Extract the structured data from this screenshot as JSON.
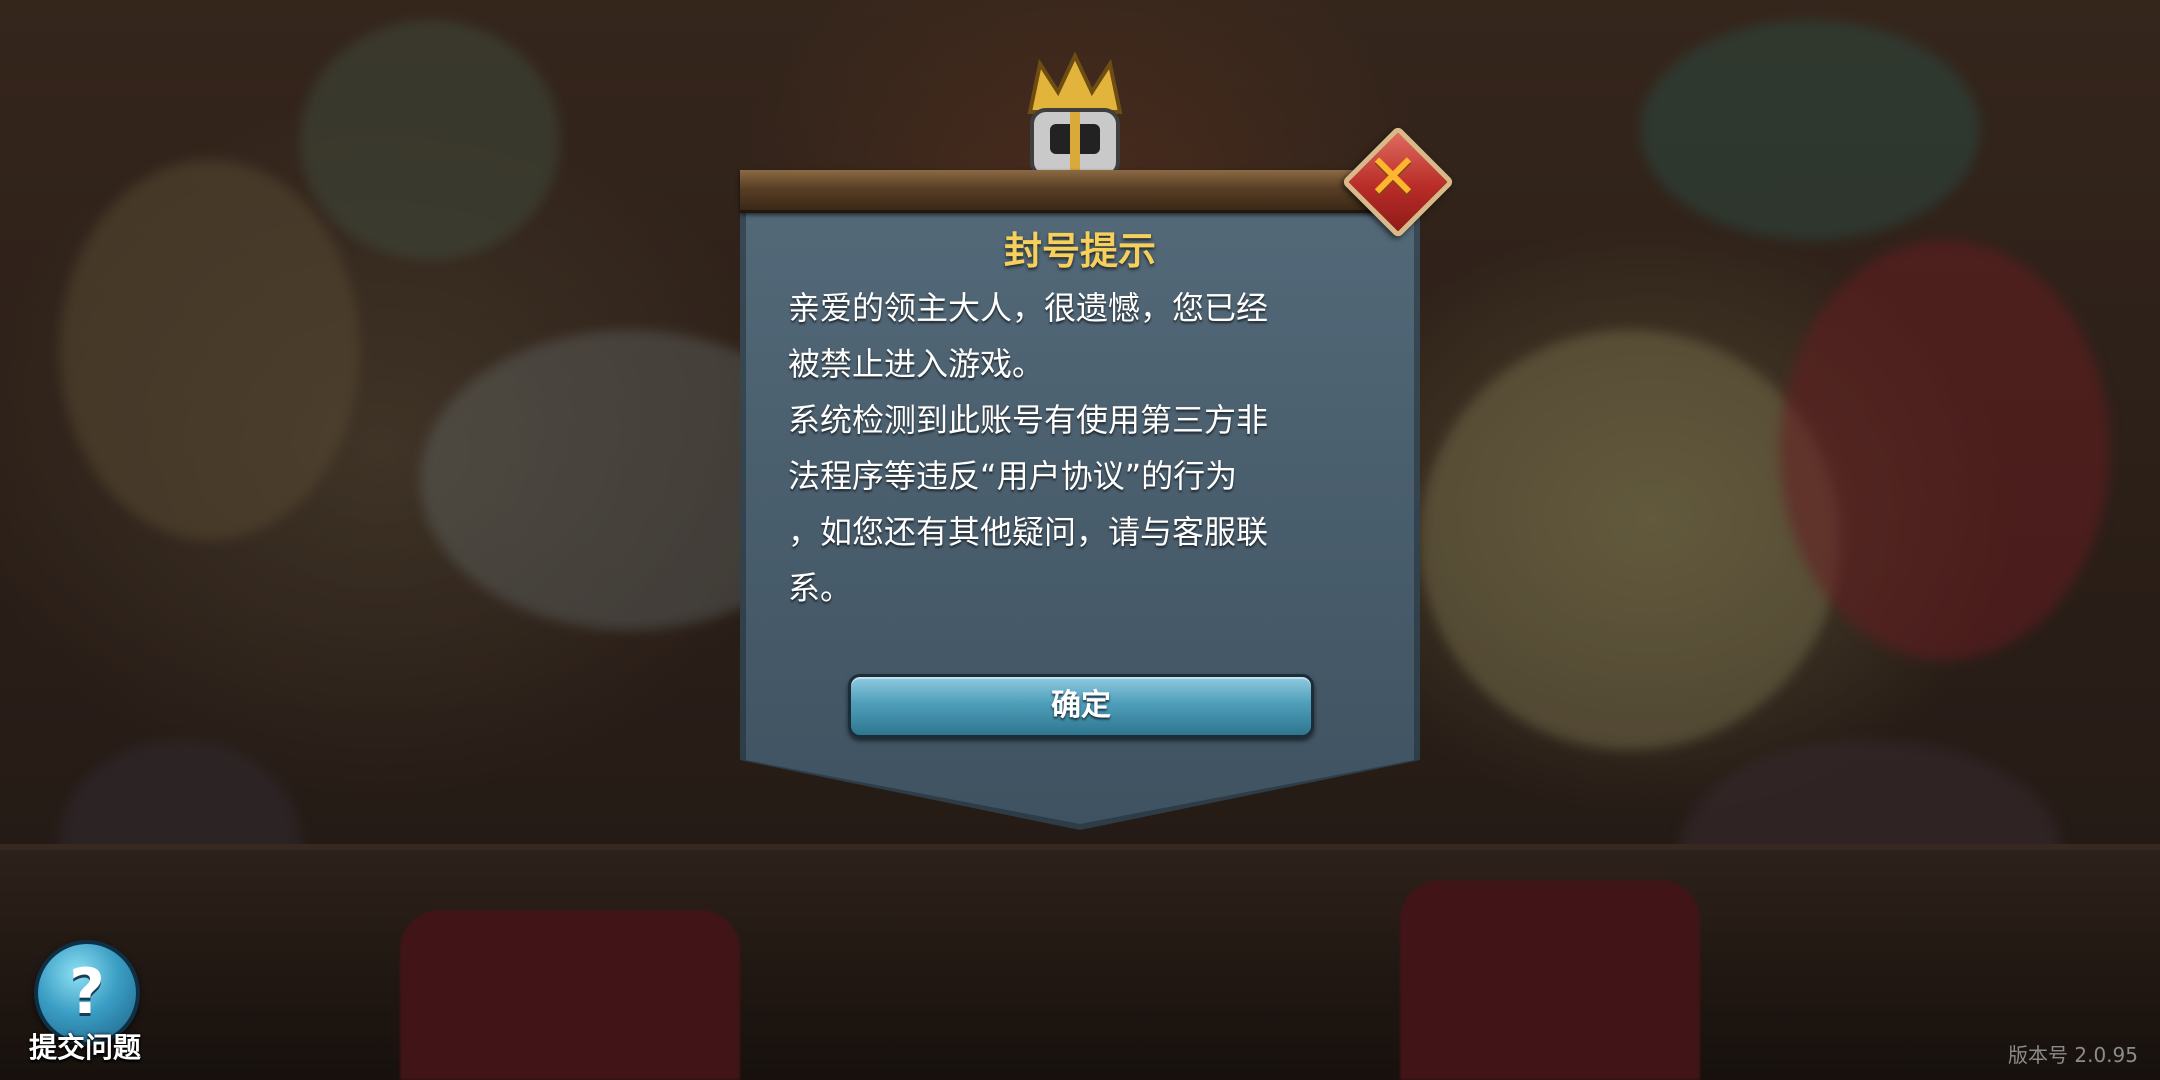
{
  "dialog": {
    "title": "封号提示",
    "message": "亲爱的领主大人，很遗憾，您已经\n被禁止进入游戏。\n系统检测到此账号有使用第三方非\n法程序等违反“用户协议”的行为\n，如您还有其他疑问，请与客服联\n系。",
    "confirm_label": "确定",
    "close_icon": "close-icon"
  },
  "help": {
    "icon": "question-mark-icon",
    "label": "提交问题"
  },
  "footer": {
    "version": "版本号 2.0.95"
  },
  "colors": {
    "title": "#f6d05a",
    "confirm_button": "#4f9fba",
    "close_button": "#b82c28"
  }
}
